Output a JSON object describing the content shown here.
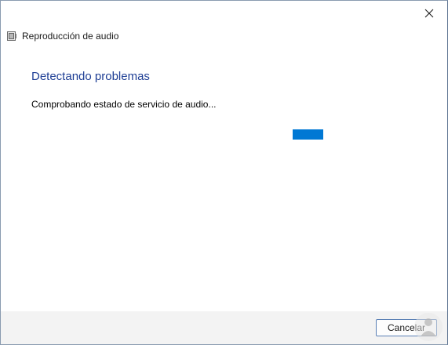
{
  "window": {
    "title": "Reproducción de audio",
    "close_icon": "close-icon",
    "app_icon": "audio-troubleshooter-icon"
  },
  "main": {
    "heading": "Detectando problemas",
    "status": "Comprobando estado de servicio de audio...",
    "progress_state": "indeterminate"
  },
  "footer": {
    "cancel_label": "Cancelar"
  },
  "colors": {
    "heading": "#1f3f95",
    "progress": "#0078d4",
    "footer_bg": "#f3f3f3",
    "button_border": "#5a7fb5"
  }
}
